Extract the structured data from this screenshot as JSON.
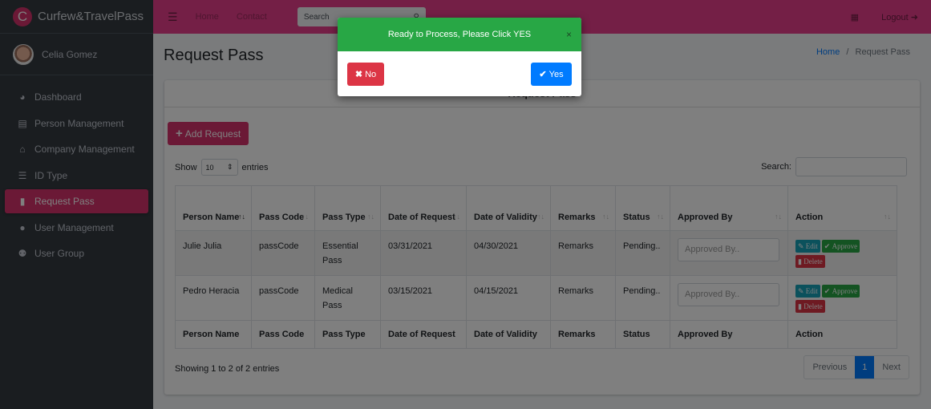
{
  "brand": {
    "logo_letter": "C",
    "name": "Curfew&TravelPass"
  },
  "user": {
    "name": "Celia Gomez"
  },
  "sidebar": {
    "items": [
      {
        "label": "Dashboard",
        "icon": "tachometer-icon",
        "glyph": "◕",
        "active": false
      },
      {
        "label": "Person Management",
        "icon": "id-card-icon",
        "glyph": "▤",
        "active": false
      },
      {
        "label": "Company Management",
        "icon": "bank-icon",
        "glyph": "⌂",
        "active": false
      },
      {
        "label": "ID Type",
        "icon": "list-ol-icon",
        "glyph": "☰",
        "active": false
      },
      {
        "label": "Request Pass",
        "icon": "file-icon",
        "glyph": "▮",
        "active": true
      },
      {
        "label": "User Management",
        "icon": "user-icon",
        "glyph": "●",
        "active": false
      },
      {
        "label": "User Group",
        "icon": "users-icon",
        "glyph": "⚉",
        "active": false
      }
    ]
  },
  "topbar": {
    "menu_glyph": "☰",
    "links": [
      "Home",
      "Contact"
    ],
    "search_placeholder": "Search",
    "search_glyph": "⚲",
    "grid_glyph": "▦",
    "logout_label": "Logout ➜"
  },
  "page": {
    "title": "Request Pass",
    "breadcrumb": {
      "home": "Home",
      "separator": "/",
      "current": "Request Pass"
    }
  },
  "card": {
    "header": "Request Pass",
    "add_button": "Add Request",
    "length": {
      "show": "Show",
      "value": "10",
      "entries": "entries"
    },
    "search_label": "Search:",
    "columns": [
      "Person Name",
      "Pass Code",
      "Pass Type",
      "Date of Request",
      "Date of Validity",
      "Remarks",
      "Status",
      "Approved By",
      "Action"
    ],
    "rows": [
      {
        "person_name": "Julie Julia",
        "pass_code": "passCode",
        "pass_type": "Essential Pass",
        "date_request": "03/31/2021",
        "date_validity": "04/30/2021",
        "remarks": "Remarks",
        "status": "Pending..",
        "approved_by_placeholder": "Approved By.."
      },
      {
        "person_name": "Pedro Heracia",
        "pass_code": "passCode",
        "pass_type": "Medical Pass",
        "date_request": "03/15/2021",
        "date_validity": "04/15/2021",
        "remarks": "Remarks",
        "status": "Pending..",
        "approved_by_placeholder": "Approved By.."
      }
    ],
    "actions": {
      "edit": "Edit",
      "approve": "Approve",
      "delete": "Delete"
    },
    "info": "Showing 1 to 2 of 2 entries",
    "pagination": {
      "previous": "Previous",
      "current": "1",
      "next": "Next"
    }
  },
  "modal": {
    "title": "Ready to Process, Please Click YES",
    "close": "×",
    "no_label": "No",
    "yes_label": "Yes"
  },
  "colors": {
    "brand": "#e83e8c",
    "active": "#d6336c",
    "success": "#28a745",
    "danger": "#dc3545",
    "primary": "#007bff",
    "info": "#17a2b8"
  }
}
